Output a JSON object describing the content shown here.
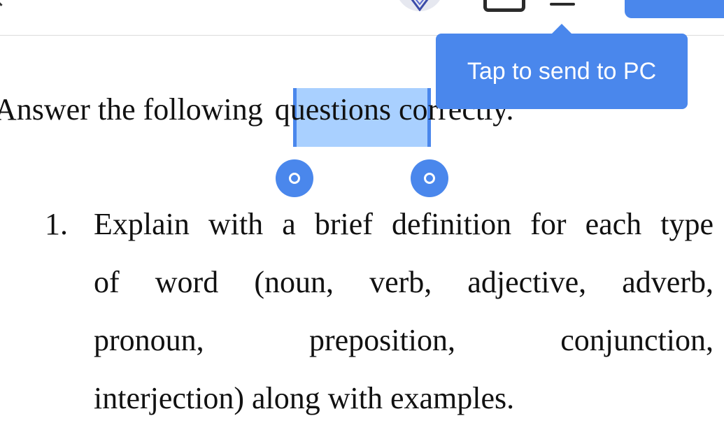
{
  "toolbar": {
    "back_icon": "chevron-left-icon",
    "avatar_icon": "avatar",
    "square_icon": "window-icon",
    "pc_icon": "computer-icon"
  },
  "tooltip": {
    "text": "Tap to send to PC"
  },
  "document": {
    "instruction": {
      "before": "Answer the following ",
      "selected": "questions",
      "after": " correctly."
    },
    "list_number": "1.",
    "item_lines": [
      [
        "Explain",
        "with",
        "a",
        "brief",
        "definition",
        "for",
        "each",
        "type"
      ],
      [
        "of",
        "word",
        "(noun,",
        "verb,",
        "adjective,",
        "adverb,"
      ],
      [
        "pronoun,",
        "preposition,",
        "conjunction,"
      ],
      [
        "interjection) along with examples."
      ]
    ]
  },
  "colors": {
    "accent": "#4a87ec",
    "selection": "#a9d0ff"
  }
}
